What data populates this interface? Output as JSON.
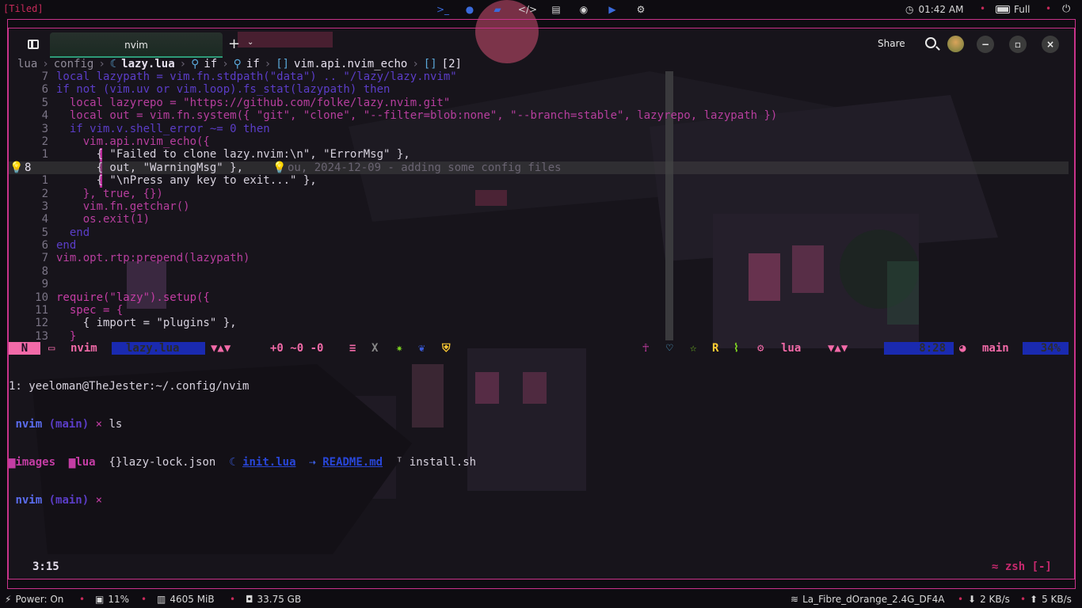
{
  "topbar": {
    "tiled_label": "[Tiled]",
    "icons": [
      "terminal-icon",
      "browser-icon",
      "folder-icon",
      "code-icon",
      "book-icon",
      "chat-icon",
      "youtube-icon",
      "gear-icon"
    ],
    "clock": "01:42 AM",
    "battery": "Full"
  },
  "tabs": {
    "active_tab": "nvim",
    "share_label": "Share"
  },
  "breadcrumb": [
    "lua",
    "config",
    "lazy.lua",
    "if",
    "if",
    "vim.api.nvim_echo",
    "[2]"
  ],
  "editor": {
    "lines": [
      {
        "ln": "7",
        "text": "local lazypath = vim.fn.stdpath(\"data\") .. \"/lazy/lazy.nvim\""
      },
      {
        "ln": "6",
        "text": "if not (vim.uv or vim.loop).fs_stat(lazypath) then"
      },
      {
        "ln": "5",
        "text": "  local lazyrepo = \"https://github.com/folke/lazy.nvim.git\""
      },
      {
        "ln": "4",
        "text": "  local out = vim.fn.system({ \"git\", \"clone\", \"--filter=blob:none\", \"--branch=stable\", lazyrepo, lazypath })"
      },
      {
        "ln": "3",
        "text": "  if vim.v.shell_error ~= 0 then"
      },
      {
        "ln": "2",
        "text": "    vim.api.nvim_echo({"
      },
      {
        "ln": "1",
        "text": "      { \"Failed to clone lazy.nvim:\\n\", \"ErrorMsg\" },"
      },
      {
        "ln": "8",
        "text": "      { out, \"WarningMsg\" },"
      },
      {
        "ln": "1",
        "text": "      { \"\\nPress any key to exit...\" },"
      },
      {
        "ln": "2",
        "text": "    }, true, {})"
      },
      {
        "ln": "3",
        "text": "    vim.fn.getchar()"
      },
      {
        "ln": "4",
        "text": "    os.exit(1)"
      },
      {
        "ln": "5",
        "text": "  end"
      },
      {
        "ln": "6",
        "text": "end"
      },
      {
        "ln": "7",
        "text": "vim.opt.rtp:prepend(lazypath)"
      },
      {
        "ln": "8",
        "text": ""
      },
      {
        "ln": "9",
        "text": ""
      },
      {
        "ln": "10",
        "text": "require(\"lazy\").setup({"
      },
      {
        "ln": "11",
        "text": "  spec = {"
      },
      {
        "ln": "12",
        "text": "    { import = \"plugins\" },"
      },
      {
        "ln": "13",
        "text": "  }"
      }
    ],
    "blame": "ou, 2024-12-09 - adding some config files"
  },
  "statusline": {
    "mode": "N",
    "file": "nvim",
    "filename": "lazy.lua",
    "diff": "+0 ~0 -0",
    "ft": "lua",
    "position": "8:28",
    "branch": "main",
    "percent": "34%"
  },
  "terminal": {
    "title": "1: yeeloman@TheJester:~/.config/nvim",
    "prompt_dir": "nvim",
    "prompt_branch": "(main)",
    "prompt_x": "×",
    "command": "ls",
    "entries": [
      "images",
      "lua",
      "lazy-lock.json",
      "init.lua",
      "README.md",
      "install.sh"
    ]
  },
  "tmux": {
    "left": "3:15",
    "right": "≈ zsh [-]"
  },
  "bottombar": {
    "power": "Power: On",
    "cpu": "11%",
    "mem": "4605 MiB",
    "disk": "33.75 GB",
    "wifi": "La_Fibre_dOrange_2.4G_DF4A",
    "down": "2 KB/s",
    "up": "5 KB/s"
  }
}
